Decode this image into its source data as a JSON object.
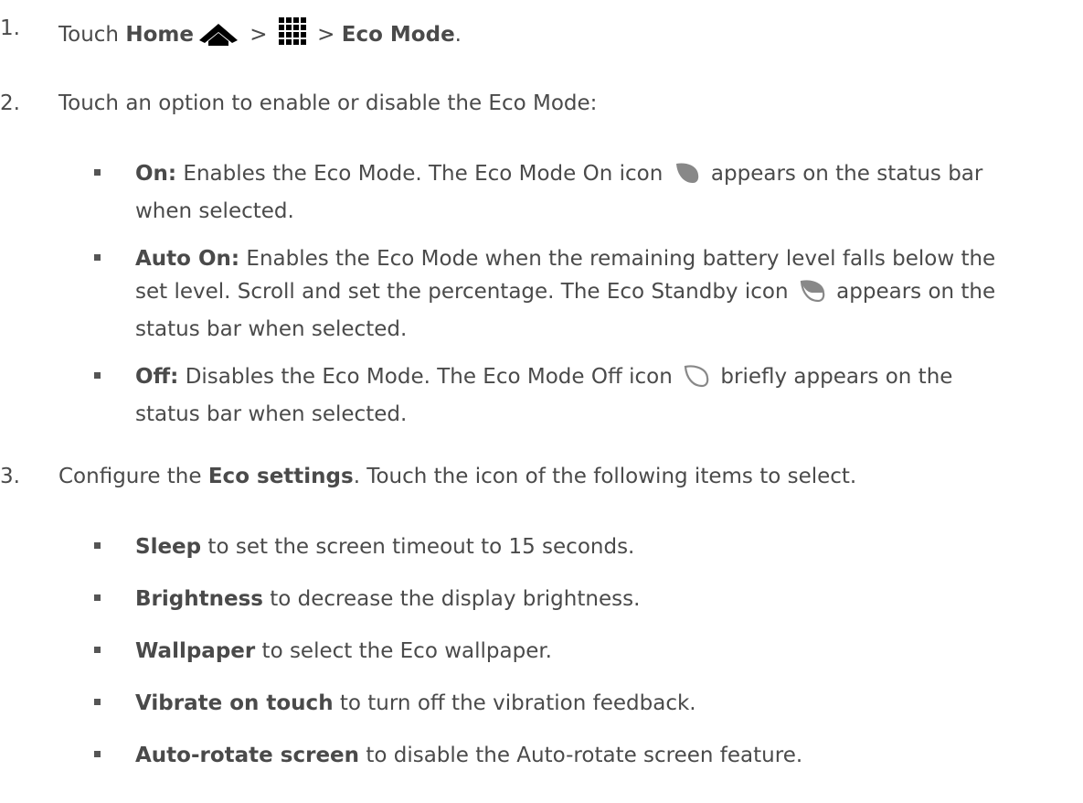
{
  "steps": [
    {
      "num": "1.",
      "parts": {
        "a": "Touch ",
        "b": "Home",
        "c": " > ",
        "d": " > ",
        "e": "Eco Mode",
        "f": "."
      }
    },
    {
      "num": "2.",
      "text": "Touch an option to enable or disable the Eco Mode:",
      "options": [
        {
          "label": "On:",
          "line1a": " Enables the Eco Mode. The Eco Mode On icon ",
          "line1b": " appears on the status bar",
          "line2": "when selected."
        },
        {
          "label": "Auto On:",
          "line1": " Enables the Eco Mode when the remaining battery level falls below the",
          "line2a": "set level. Scroll and set the percentage. The Eco Standby icon ",
          "line2b": " appears on the",
          "line3": "status bar when selected."
        },
        {
          "label": "Off:",
          "line1a": " Disables the Eco Mode. The Eco Mode Off icon ",
          "line1b": " briefly appears on the",
          "line2": "status bar when selected."
        }
      ]
    },
    {
      "num": "3.",
      "parts": {
        "a": "Configure the ",
        "b": "Eco settings",
        "c": ". Touch the icon of the following items to select."
      },
      "items": [
        {
          "label": "Sleep",
          "text": " to set the screen timeout to 15 seconds."
        },
        {
          "label": "Brightness",
          "text": " to decrease the display brightness."
        },
        {
          "label": "Wallpaper",
          "text": " to select the Eco wallpaper."
        },
        {
          "label": "Vibrate on touch",
          "text": " to turn off the vibration feedback."
        },
        {
          "label": "Auto-rotate screen",
          "text": " to disable the Auto-rotate screen feature."
        }
      ]
    }
  ],
  "icons": {
    "home": "home-icon",
    "apps": "apps-grid-icon",
    "eco_on": "leaf-filled-icon",
    "eco_standby": "leaf-half-icon",
    "eco_off": "leaf-outline-icon"
  }
}
